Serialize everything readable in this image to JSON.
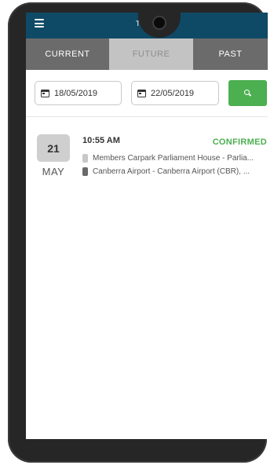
{
  "header": {
    "menu_icon": "hamburger-menu-icon",
    "char": "T"
  },
  "tabs": [
    {
      "label": "CURRENT",
      "active": false
    },
    {
      "label": "FUTURE",
      "active": true
    },
    {
      "label": "PAST",
      "active": false
    }
  ],
  "filters": {
    "from_date": "18/05/2019",
    "to_date": "22/05/2019",
    "calendar_icon": "calendar-icon",
    "search_icon": "search-icon",
    "search_color": "#4caf50"
  },
  "bookings": [
    {
      "day": "21",
      "month": "MAY",
      "time": "10:55 AM",
      "status": "CONFIRMED",
      "status_color": "#4caf50",
      "pickup": "Members Carpark Parliament House - Parlia...",
      "dropoff": "Canberra Airport - Canberra Airport (CBR), ..."
    }
  ],
  "colors": {
    "header_bg": "#0e4a66",
    "tab_bg": "#6b6b6b",
    "tab_active_bg": "#c3c3c3"
  }
}
